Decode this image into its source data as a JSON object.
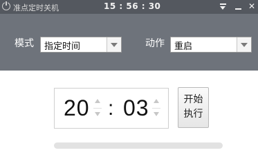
{
  "window": {
    "title": "准点定时关机",
    "clock": "15 : 56 : 30",
    "icons": [
      "power-icon",
      "menu-icon",
      "minimize-icon",
      "close-icon"
    ],
    "close_glyph": "✕"
  },
  "controls": {
    "mode_label": "模式",
    "mode_value": "指定时间",
    "action_label": "动作",
    "action_value": "重启"
  },
  "time": {
    "hour": "20",
    "separator": ":",
    "minute": "03"
  },
  "start_button": {
    "line1": "开始",
    "line2": "执行"
  },
  "progress": {
    "fraction": 0.0
  },
  "colors": {
    "titlebar": "#54585f",
    "toolbar": "#6e737b",
    "progress_track": "#e2e2e2"
  }
}
